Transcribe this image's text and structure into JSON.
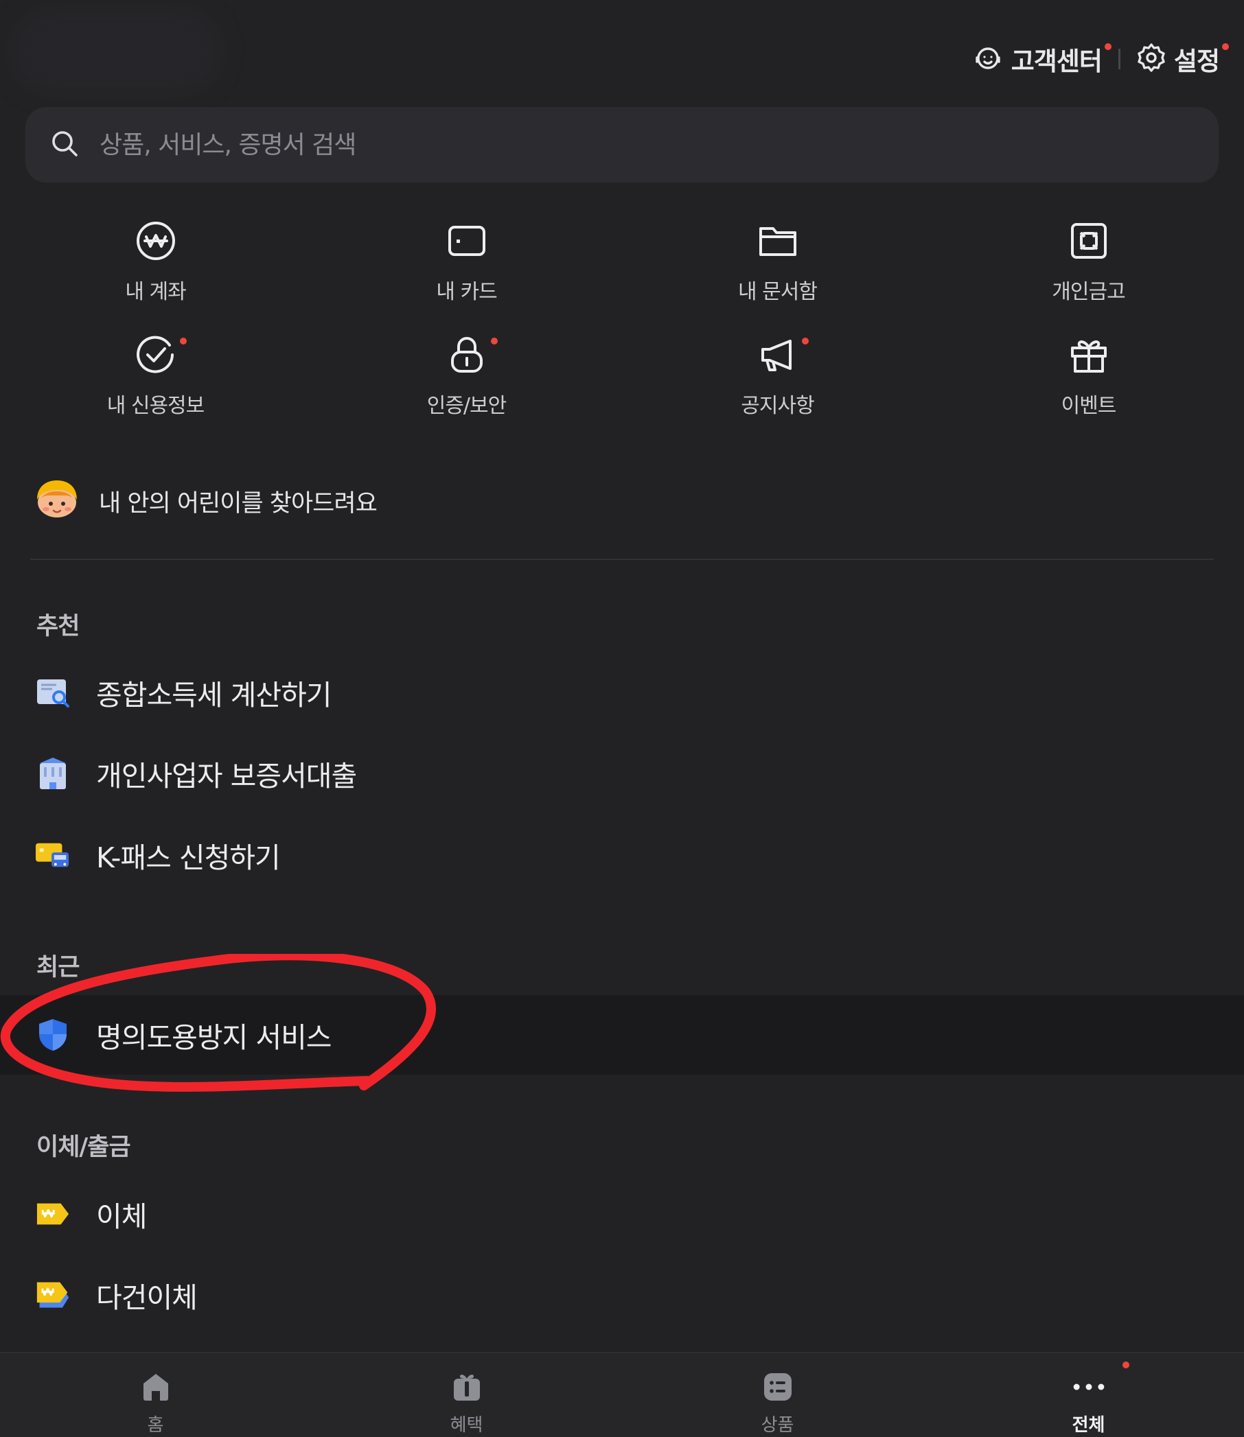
{
  "header": {
    "customer_center_label": "고객센터",
    "settings_label": "설정"
  },
  "search": {
    "placeholder": "상품, 서비스, 증명서 검색"
  },
  "quick_menu": [
    {
      "label": "내 계좌",
      "icon": "won-circle-icon",
      "badge": false
    },
    {
      "label": "내 카드",
      "icon": "card-icon",
      "badge": false
    },
    {
      "label": "내 문서함",
      "icon": "folder-icon",
      "badge": false
    },
    {
      "label": "개인금고",
      "icon": "safe-icon",
      "badge": false
    },
    {
      "label": "내 신용정보",
      "icon": "check-circle-icon",
      "badge": true
    },
    {
      "label": "인증/보안",
      "icon": "lock-icon",
      "badge": true
    },
    {
      "label": "공지사항",
      "icon": "megaphone-icon",
      "badge": true
    },
    {
      "label": "이벤트",
      "icon": "gift-icon",
      "badge": false
    }
  ],
  "banner": {
    "label": "내 안의 어린이를 찾아드려요"
  },
  "recommended": {
    "title": "추천",
    "items": [
      {
        "label": "종합소득세 계산하기",
        "icon": "tax-document-icon"
      },
      {
        "label": "개인사업자 보증서대출",
        "icon": "building-icon"
      },
      {
        "label": "K-패스 신청하기",
        "icon": "transit-card-icon"
      }
    ]
  },
  "recent": {
    "title": "최근",
    "items": [
      {
        "label": "명의도용방지 서비스",
        "icon": "shield-icon"
      }
    ]
  },
  "transfer": {
    "title": "이체/출금",
    "items": [
      {
        "label": "이체",
        "icon": "won-tag-icon"
      },
      {
        "label": "다건이체",
        "icon": "multi-won-tag-icon"
      }
    ]
  },
  "bottom_nav": [
    {
      "label": "홈",
      "icon": "home-icon",
      "active": false
    },
    {
      "label": "혜택",
      "icon": "benefit-gift-icon",
      "active": false
    },
    {
      "label": "상품",
      "icon": "product-list-icon",
      "active": false
    },
    {
      "label": "전체",
      "icon": "more-dots-icon",
      "active": true
    }
  ],
  "colors": {
    "background": "#222224",
    "badge": "#f0463c",
    "annotation": "#f0252c",
    "shield_blue": "#3b82f6",
    "won_yellow": "#f5c518"
  }
}
